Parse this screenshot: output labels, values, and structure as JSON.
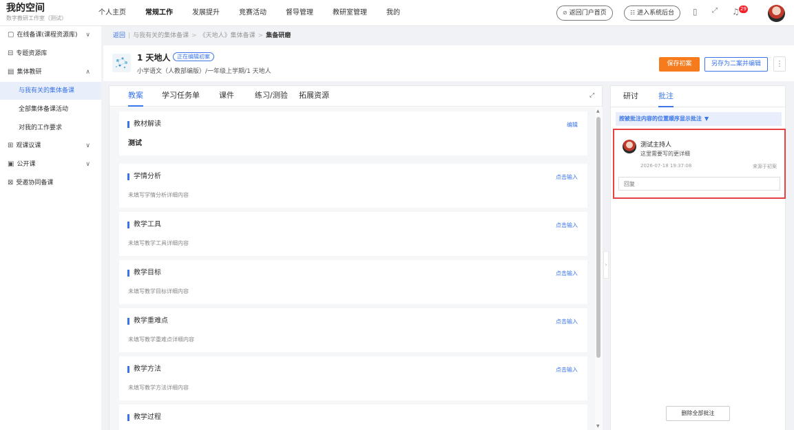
{
  "brand": {
    "title": "我的空间",
    "subtitle": "数字教研工作室（测试）"
  },
  "nav": [
    "个人主页",
    "常规工作",
    "发展提升",
    "竞赛活动",
    "督导管理",
    "教研室管理",
    "我的"
  ],
  "nav_active_index": 1,
  "top_buttons": {
    "portal": "返回门户首页",
    "admin": "进入系统后台"
  },
  "notifications": {
    "count": "29"
  },
  "sidebar": {
    "items": [
      {
        "label": "在线备课(课程资源库)",
        "icon": "file-icon",
        "chevron": "∨"
      },
      {
        "label": "专题资源库",
        "icon": "folder-icon"
      },
      {
        "label": "集体教研",
        "icon": "list-icon",
        "chevron": "∧"
      }
    ],
    "sub_items": [
      {
        "label": "与我有关的集体备课",
        "active": true
      },
      {
        "label": "全部集体备课活动"
      },
      {
        "label": "对我的工作要求"
      }
    ],
    "lower_items": [
      {
        "label": "观课议课",
        "icon": "grid-icon",
        "chevron": "∨"
      },
      {
        "label": "公开课",
        "icon": "video-icon",
        "chevron": "∨"
      },
      {
        "label": "受邀协同备课",
        "icon": "group-icon"
      }
    ]
  },
  "breadcrumb": {
    "back": "返回",
    "path1": "与我有关的集体备课",
    "path2": "《天地人》集体备课",
    "current": "集备研磨"
  },
  "lesson": {
    "title": "1 天地人",
    "tag": "正在编辑初案",
    "subtitle": "小学语文（人教部编版）/一年级上学期/1 天地人"
  },
  "actions": {
    "save": "保存初案",
    "save_as": "另存为二案并编辑",
    "more": "⋮"
  },
  "main_tabs": [
    "教案",
    "学习任务单",
    "课件",
    "练习/测验",
    "拓展资源"
  ],
  "sections": [
    {
      "title": "教材解读",
      "action": "编辑",
      "body": "测试",
      "filled": true
    },
    {
      "title": "学情分析",
      "action": "点击输入",
      "body": "未填写学情分析详细内容"
    },
    {
      "title": "教学工具",
      "action": "点击输入",
      "body": "未填写教学工具详细内容"
    },
    {
      "title": "教学目标",
      "action": "点击输入",
      "body": "未填写教学目标详细内容"
    },
    {
      "title": "教学重难点",
      "action": "点击输入",
      "body": "未填写教学重难点详细内容"
    },
    {
      "title": "教学方法",
      "action": "点击输入",
      "body": "未填写教学方法详细内容"
    },
    {
      "title": "教学过程",
      "action": "",
      "body": ""
    }
  ],
  "right_tabs": [
    "研讨",
    "批注"
  ],
  "right_panel": {
    "sort_label": "按被批注内容的位置顺序显示批注",
    "comment": {
      "author": "测试主持人",
      "text": "这里需要写的更详细",
      "time": "2026-07-18 19:37:08",
      "source": "来源于初案",
      "reply_placeholder": "回复"
    },
    "delete_all": "删除全部批注"
  },
  "colors": {
    "accent": "#3a74e8",
    "save": "#f57b1d",
    "highlight_border": "#e84040"
  }
}
